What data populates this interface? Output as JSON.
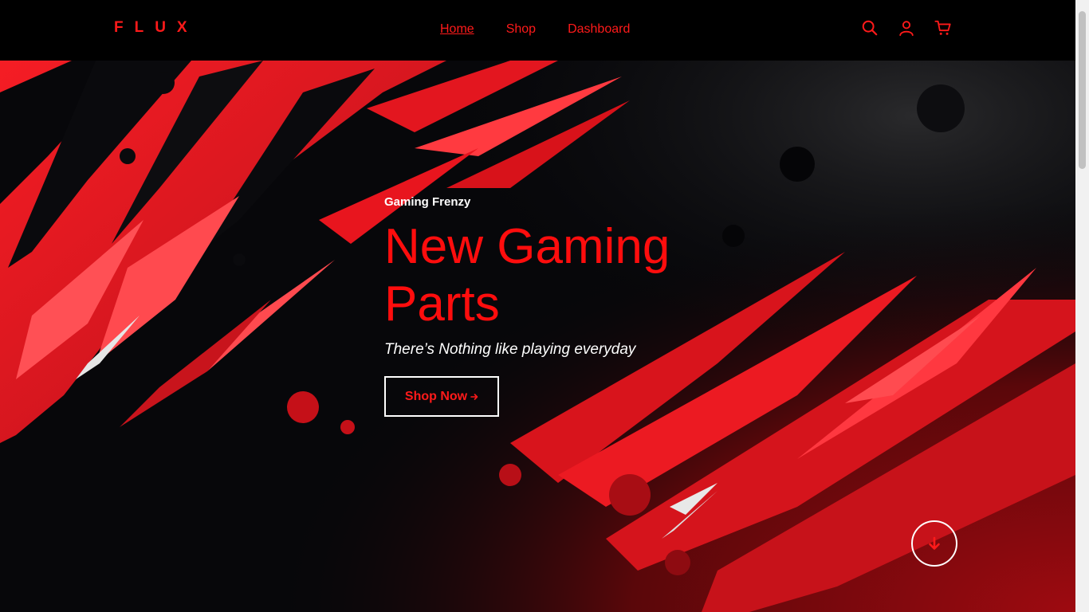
{
  "brand": {
    "logo": "FLUX",
    "accent": "#ff1a1a"
  },
  "nav": {
    "links": [
      {
        "label": "Home",
        "active": true
      },
      {
        "label": "Shop",
        "active": false
      },
      {
        "label": "Dashboard",
        "active": false
      }
    ],
    "icons": [
      "search-icon",
      "user-icon",
      "cart-icon"
    ]
  },
  "hero": {
    "eyebrow": "Gaming Frenzy",
    "headline": "New Gaming Parts",
    "subtitle": "There’s Nothing like playing everyday",
    "cta_label": "Shop Now",
    "cta_icon": "arrow-right-icon",
    "scroll_icon": "arrow-down-icon",
    "colors": {
      "headline": "#ff0d0d",
      "background_dark": "#07070a",
      "splash_red": "#e0141c"
    }
  }
}
